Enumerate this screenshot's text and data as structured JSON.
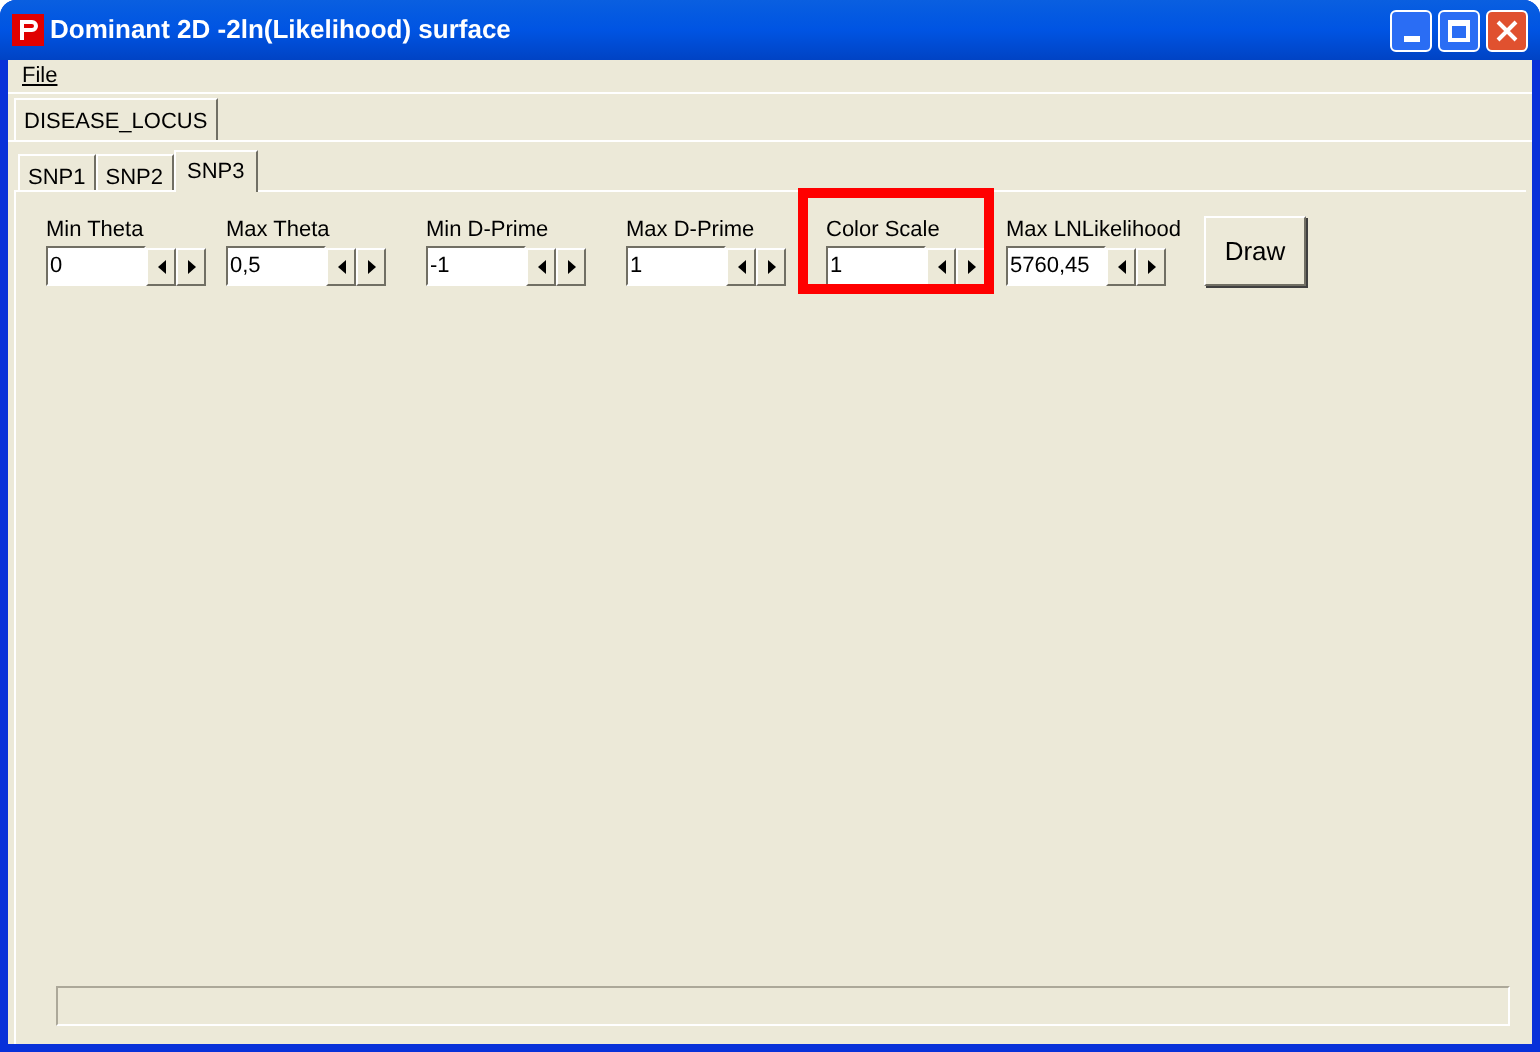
{
  "window": {
    "title": "Dominant 2D -2ln(Likelihood) surface"
  },
  "menu": [
    {
      "label": "File"
    }
  ],
  "outer_tabs": [
    {
      "label": "DISEASE_LOCUS",
      "selected": true
    }
  ],
  "tabs": [
    {
      "label": "SNP1",
      "selected": false
    },
    {
      "label": "SNP2",
      "selected": false
    },
    {
      "label": "SNP3",
      "selected": true
    }
  ],
  "fields": [
    {
      "label": "Min Theta",
      "value": "0",
      "highlighted": false
    },
    {
      "label": "Max Theta",
      "value": "0,5",
      "highlighted": false
    },
    {
      "label": "Min D-Prime",
      "value": "-1",
      "highlighted": false
    },
    {
      "label": "Max D-Prime",
      "value": "1",
      "highlighted": false
    },
    {
      "label": "Color Scale",
      "value": "1",
      "highlighted": true
    },
    {
      "label": "Max LNLikelihood",
      "value": "5760,45",
      "highlighted": false
    }
  ],
  "draw_button": {
    "label": "Draw"
  }
}
